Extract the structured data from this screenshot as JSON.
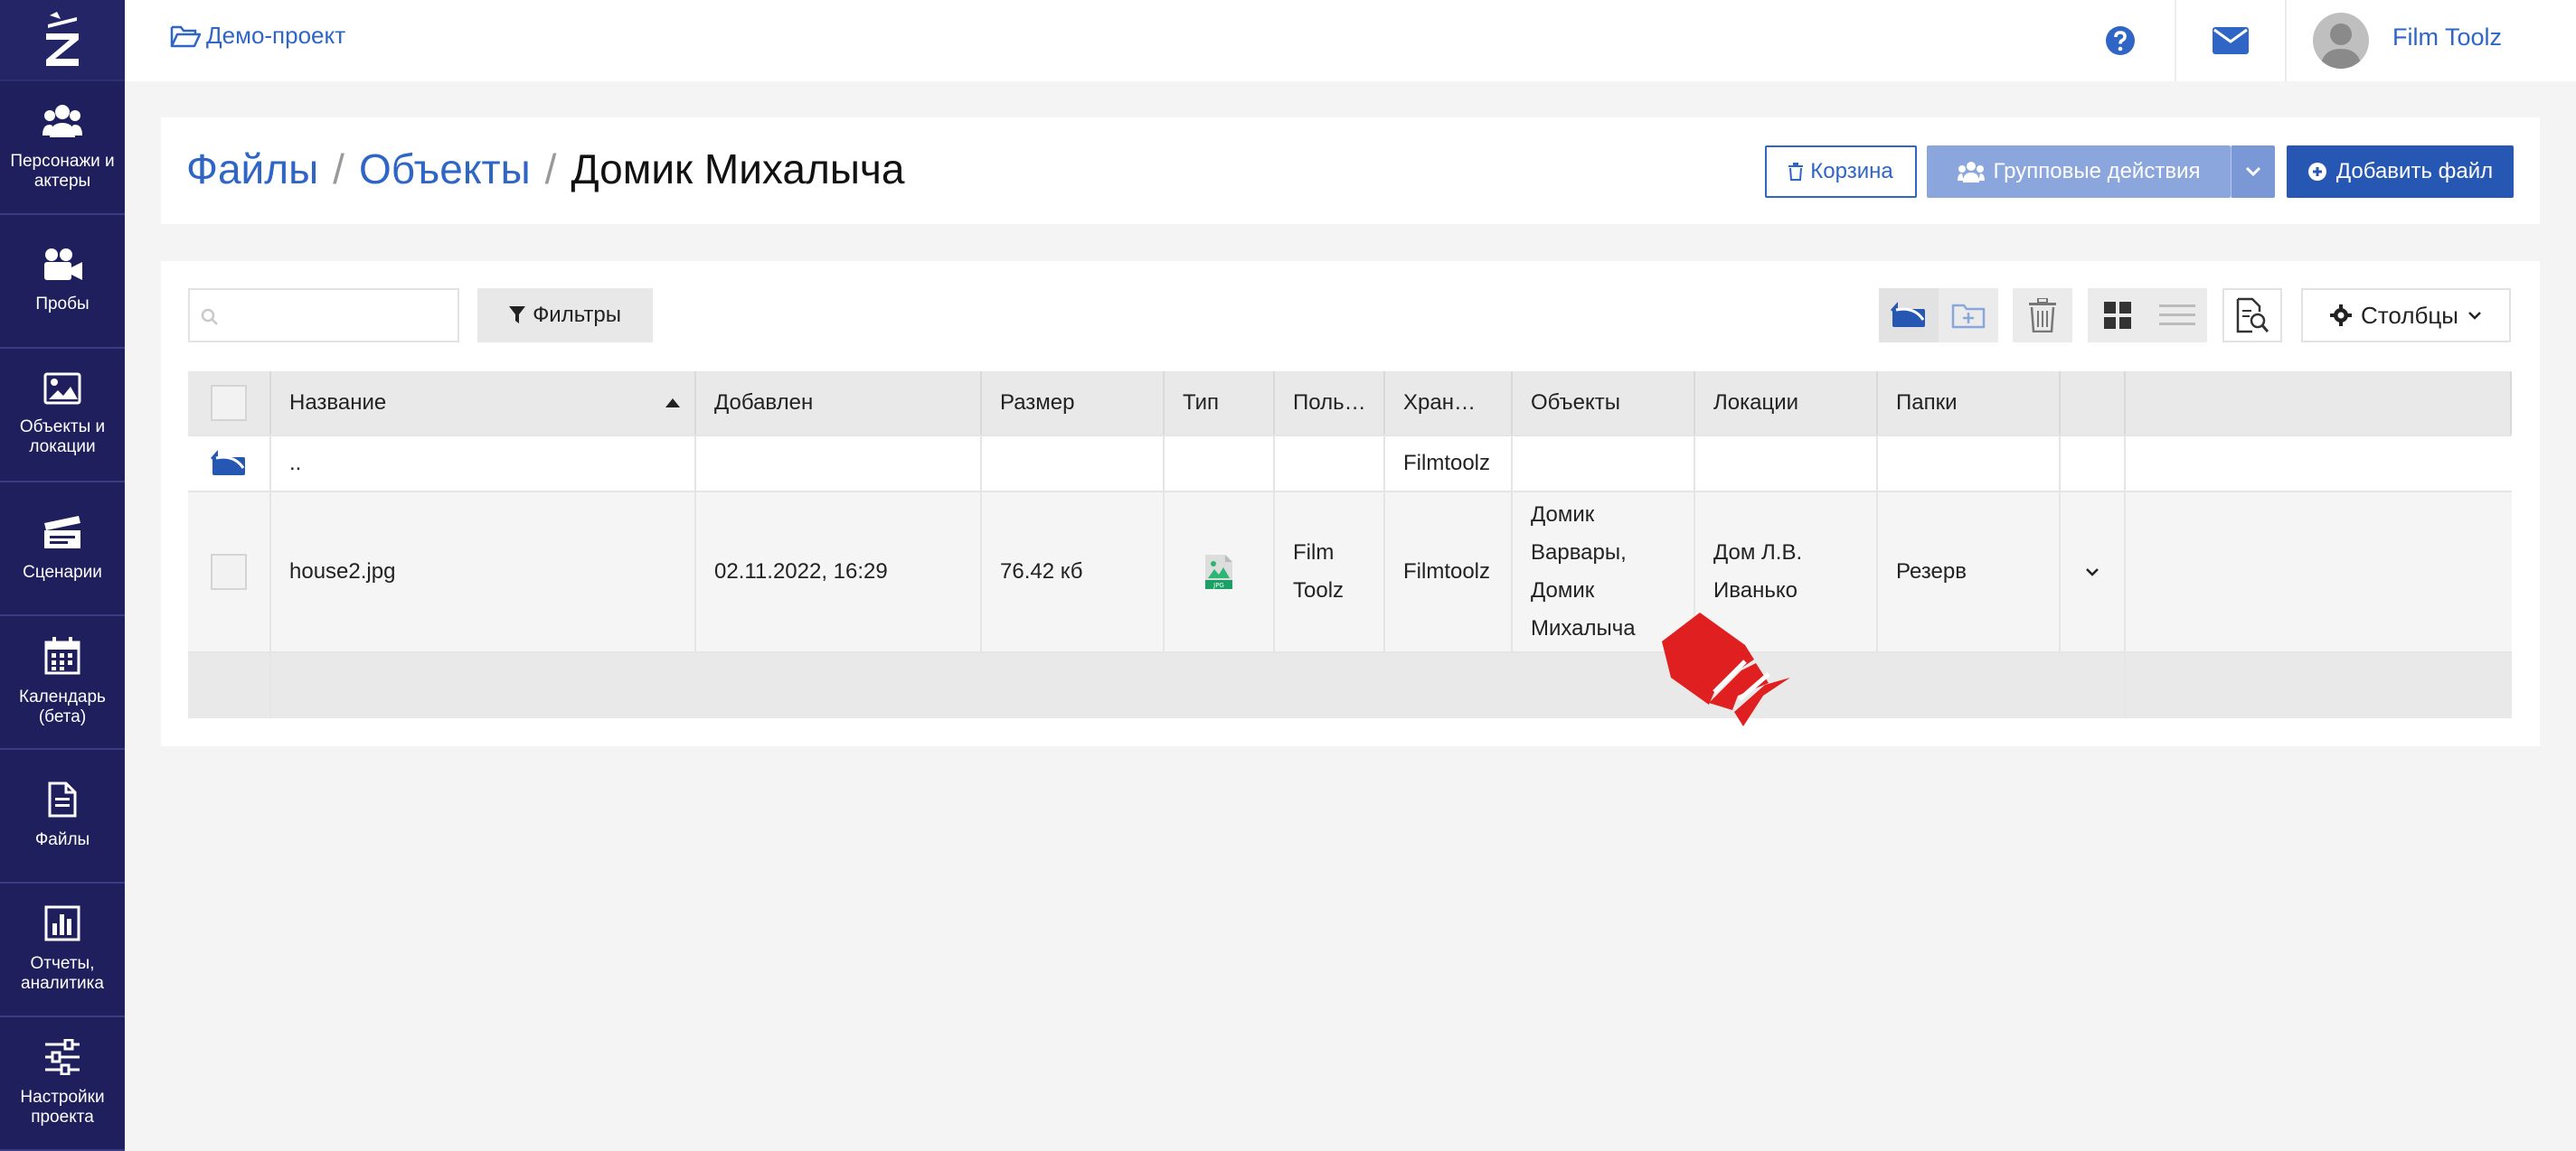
{
  "sidebar": {
    "logo": "Z",
    "items": [
      {
        "label": "Персонажи и актеры",
        "icon": "users-icon"
      },
      {
        "label": "Пробы",
        "icon": "video-camera-icon"
      },
      {
        "label": "Объекты и локации",
        "icon": "image-icon"
      },
      {
        "label": "Сценарии",
        "icon": "clapperboard-icon"
      },
      {
        "label": "Календарь (бета)",
        "icon": "calendar-icon"
      },
      {
        "label": "Файлы",
        "icon": "file-icon"
      },
      {
        "label": "Отчеты, аналитика",
        "icon": "bar-chart-icon"
      },
      {
        "label": "Настройки проекта",
        "icon": "sliders-icon"
      }
    ]
  },
  "topbar": {
    "project": "Демо-проект",
    "user_name": "Film Toolz"
  },
  "header": {
    "breadcrumb": [
      "Файлы",
      "Объекты",
      "Домик Михалыча"
    ],
    "trash_label": "Корзина",
    "group_actions_label": "Групповые действия",
    "add_file_label": "Добавить файл"
  },
  "toolbar": {
    "search_placeholder": "",
    "filters_label": "Фильтры",
    "columns_label": "Столбцы"
  },
  "table": {
    "columns": [
      "Название",
      "Добавлен",
      "Размер",
      "Тип",
      "Поль…",
      "Хран…",
      "Объекты",
      "Локации",
      "Папки"
    ],
    "sort_column": "Название",
    "parent_row": {
      "name": "..",
      "storage": "Filmtoolz"
    },
    "rows": [
      {
        "name": "house2.jpg",
        "added": "02.11.2022, 16:29",
        "size": "76.42 кб",
        "type_icon": "jpg-file-icon",
        "user_line1": "Film",
        "user_line2": "Toolz",
        "storage": "Filmtoolz",
        "objects_lines": [
          "Домик",
          "Варвары,",
          "Домик",
          "Михалыча"
        ],
        "locations_lines": [
          "Дом Л.В.",
          "Иванько"
        ],
        "folder": "Резерв"
      }
    ]
  },
  "colors": {
    "sidebar_bg": "#1e1f5c",
    "accent": "#2f66c5",
    "primary_button": "#2557b3",
    "cursor": "#e02020"
  }
}
